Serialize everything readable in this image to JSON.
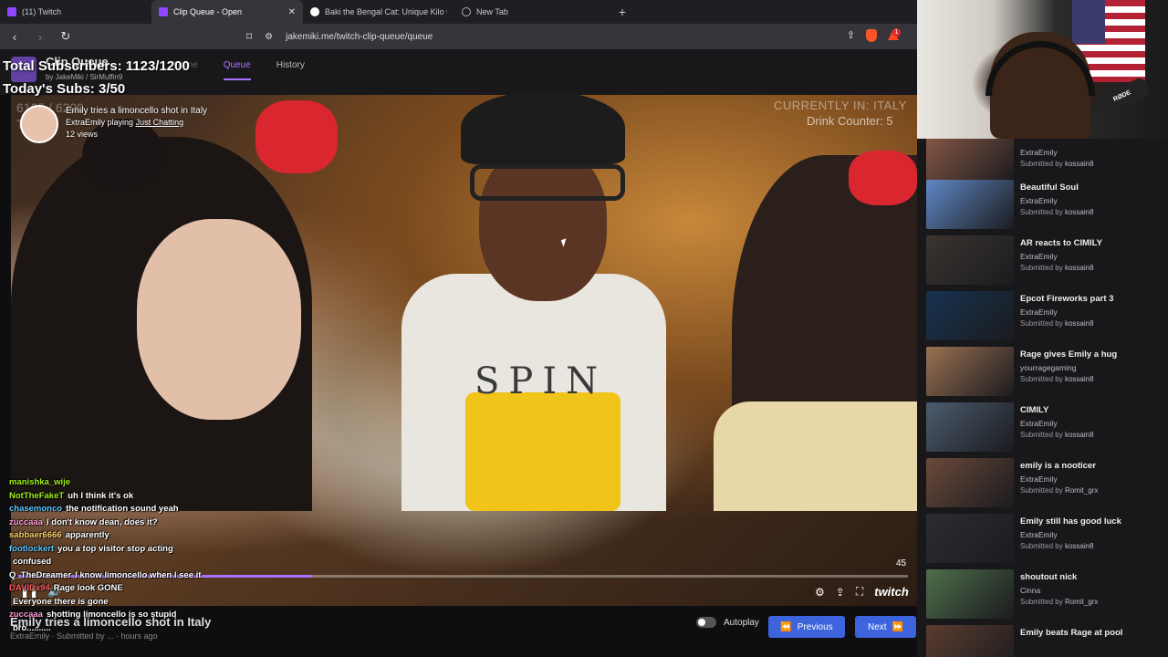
{
  "browser": {
    "tabs": [
      {
        "label": "(11) Twitch",
        "active": false
      },
      {
        "label": "Clip Queue - Open",
        "active": true
      },
      {
        "label": "Baki the Bengal Cat: Unique Kilo Cha",
        "active": false
      },
      {
        "label": "New Tab",
        "active": false
      }
    ],
    "url": "jakemiki.me/twitch-clip-queue/queue",
    "new_tab_symbol": "+"
  },
  "app": {
    "title": "Clip Queue",
    "by_line": "by  JakeMiki  /  SirMuffin9",
    "nav": [
      {
        "label": "Queue",
        "active": true
      },
      {
        "label": "History",
        "active": false
      }
    ],
    "nav_hidden_label": "Home"
  },
  "overlay": {
    "total_subs": "Total Subscribers: 1123/1200",
    "today_subs": "Today's Subs: 3/50",
    "faint_line1": "6105 / 6200",
    "faint_line2": "T",
    "country": "CURRENTLY IN: ITALY",
    "drink_counter": "Drink Counter: 5"
  },
  "clip": {
    "title": "Emily tries a limoncello shot in Italy",
    "channel": "ExtraEmily",
    "playing_text": "playing",
    "category": "Just Chatting",
    "views": "12 views",
    "timer": "45",
    "progress_fraction": 0.33
  },
  "chat": [
    {
      "user": "manishka_wije",
      "msg": "",
      "color": "c1"
    },
    {
      "user": "NotTheFakeT",
      "msg": "uh I think it's ok",
      "color": "c1"
    },
    {
      "user": "chasemonco",
      "msg": "the notification sound yeah",
      "color": "c2"
    },
    {
      "user": "zuccaaa",
      "msg": "I don't know dean, does it?",
      "color": "c3"
    },
    {
      "user": "sabbaer6666",
      "msg": "apparently",
      "color": "c4"
    },
    {
      "user": "footlockert",
      "msg": "you a top visitor stop acting",
      "color": "c2"
    },
    {
      "user": "",
      "msg": "confused",
      "color": "c5"
    },
    {
      "user": "Q_TheDreamer",
      "msg": "I know limoncello when I see it",
      "color": "c5"
    },
    {
      "user": "DAVIDx94",
      "msg": "Rage look GONE",
      "color": "c7"
    },
    {
      "user": "",
      "msg": "Everyone there is gone",
      "color": "c6"
    },
    {
      "user": "",
      "msg": "",
      "color": "c5"
    },
    {
      "user": "zuccaaa",
      "msg": "shotting limoncello is so stupid",
      "color": "c3"
    },
    {
      "user": "",
      "msg": "bro..........",
      "color": "c5"
    }
  ],
  "bottom": {
    "title": "Emily tries a limoncello shot in Italy",
    "meta": "ExtraEmily  ·  Submitted by ...  ·  hours ago",
    "autoplay_label": "Autoplay",
    "previous_label": "Previous",
    "next_label": "Next"
  },
  "webcam": {
    "mic_brand": "RØDE"
  },
  "queue": [
    {
      "title": "",
      "channel": "ExtraEmily",
      "submitter": "kossain8",
      "thumb": "#8a5a46"
    },
    {
      "title": "Beautiful Soul",
      "channel": "ExtraEmily",
      "submitter": "kossain8",
      "thumb": "#5f88c4"
    },
    {
      "title": "AR reacts to CIMILY",
      "channel": "ExtraEmily",
      "submitter": "kossain8",
      "thumb": "#3b3430"
    },
    {
      "title": "Epcot Fireworks part 3",
      "channel": "ExtraEmily",
      "submitter": "kossain8",
      "thumb": "#16324f"
    },
    {
      "title": "Rage gives Emily a hug",
      "channel": "yourragegaming",
      "submitter": "kossain8",
      "thumb": "#9a7152"
    },
    {
      "title": "CIMILY",
      "channel": "ExtraEmily",
      "submitter": "kossain8",
      "thumb": "#4c5c6e"
    },
    {
      "title": "emily is a nooticer",
      "channel": "ExtraEmily",
      "submitter": "Romit_grx",
      "thumb": "#6a4a3a"
    },
    {
      "title": "Emily still has good luck",
      "channel": "ExtraEmily",
      "submitter": "kossain8",
      "thumb": "#2b2d33"
    },
    {
      "title": "shoutout nick",
      "channel": "Cinna",
      "submitter": "Romit_grx",
      "thumb": "#4f6e4a"
    },
    {
      "title": "Emily beats Rage at pool",
      "channel": "",
      "submitter": "",
      "thumb": "#5a3c2e"
    }
  ],
  "queue_submitted_prefix": "Submitted by"
}
